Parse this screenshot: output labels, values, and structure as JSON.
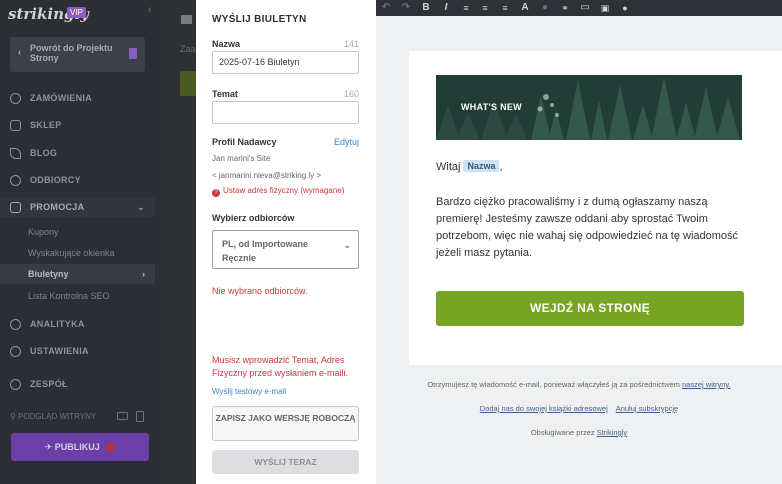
{
  "sidebar": {
    "logo": "strikingly",
    "vip": "VIP",
    "back_label": "Powrót do Projektu Strony",
    "items": {
      "orders": "ZAMÓWIENIA",
      "shop": "SKLEP",
      "blog": "BLOG",
      "audience": "ODBIORCY",
      "promo": "PROMOCJA",
      "analytics": "ANALITYKA",
      "settings": "USTAWIENIA",
      "team": "ZESPÓŁ"
    },
    "sub_items": {
      "coupons": "Kupony",
      "popups": "Wyskakujące okienka",
      "newsletters": "Biuletyny",
      "seo": "Lista Kontrolna SEO"
    },
    "preview_label": "PODGLĄD WITRYNY",
    "publish_label": "PUBLIKUJ"
  },
  "background": {
    "text_fragment": "Zaa"
  },
  "form": {
    "title": "WYŚLIJ BIULETYN",
    "name_label": "Nazwa",
    "name_count": "141",
    "name_value": "2025-07-16 Biuletyn",
    "subject_label": "Temat",
    "subject_count": "160",
    "subject_value": "",
    "sender_label": "Profil Nadawcy",
    "edit_link": "Edytuj",
    "sender_name": "Jan marini's Site",
    "sender_email": "< janmarini.nieva@striking.ly >",
    "address_warning": "Ustaw adres fizyczny (wymagane)",
    "recipients_label": "Wybierz odbiorców",
    "recipients_value": "PL, od Importowane Ręcznie",
    "no_recipients": "Nie wybrano odbiorców.",
    "subject_error": "Musisz wprowadzić Temat, Adres Fizyczny przed wysłaniem e-maili.",
    "test_email_link": "Wyślij testowy e-mail",
    "draft_button": "ZAPISZ JAKO WERSJĘ ROBOCZĄ",
    "send_button": "WYŚLIJ TERAZ"
  },
  "email": {
    "banner_text": "WHAT'S NEW",
    "greeting": "Witaj",
    "greeting_tag": "Nazwa",
    "greeting_comma": ",",
    "body": "Bardzo ciężko pracowaliśmy i z dumą ogłaszamy naszą premierę! Jesteśmy zawsze  oddani aby sprostać Twoim potrzebom, więc nie wahaj się odpowiedzieć na tę wiadomość jeżeli masz pytania.",
    "cta_label": "WEJDŹ NA STRONĘ",
    "footer_line1": "Otrzymujesz tę wiadomość e-mail, ponieważ włączyłeś ją za pośrednictwem",
    "footer_link1": "naszej witryny.",
    "footer_link2": "Dodaj nas do swojej książki adresowej",
    "footer_link3": "Anuluj subskrypcję",
    "footer_powered": "Obsługiwane przez",
    "footer_link4": "Strikingly"
  },
  "colors": {
    "accent_green": "#78a423",
    "publish_purple": "#6b3fa7",
    "error_red": "#c8383d",
    "link_blue": "#3a86c8"
  }
}
